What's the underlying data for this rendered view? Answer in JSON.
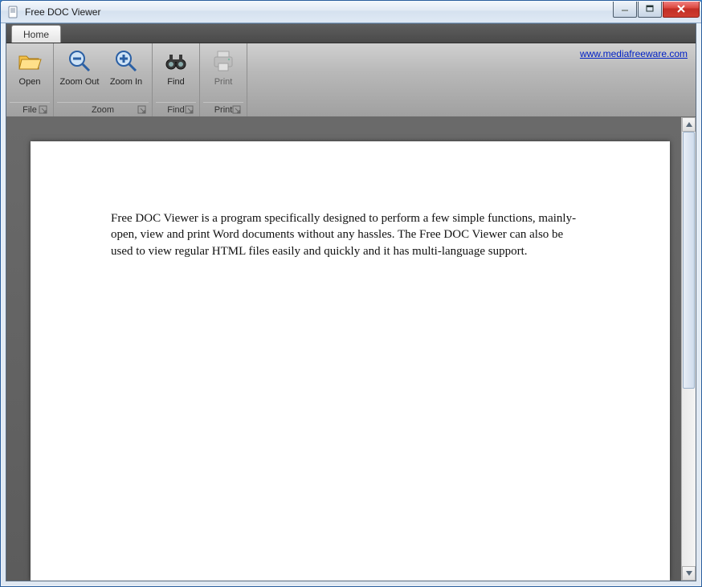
{
  "window": {
    "title": "Free DOC Viewer"
  },
  "ribbon": {
    "tab": "Home",
    "link": "www.mediafreeware.com",
    "groups": {
      "file": {
        "label": "File",
        "open": "Open"
      },
      "zoom": {
        "label": "Zoom",
        "zoom_out": "Zoom Out",
        "zoom_in": "Zoom In"
      },
      "find": {
        "label": "Find",
        "find": "Find"
      },
      "print": {
        "label": "Print",
        "print": "Print"
      }
    }
  },
  "document": {
    "paragraph": "Free DOC Viewer is a program specifically designed to perform a few simple functions, mainly- open, view and print Word documents without any hassles. The Free DOC Viewer can also be used to view regular HTML files easily and quickly and it has multi-language support."
  }
}
